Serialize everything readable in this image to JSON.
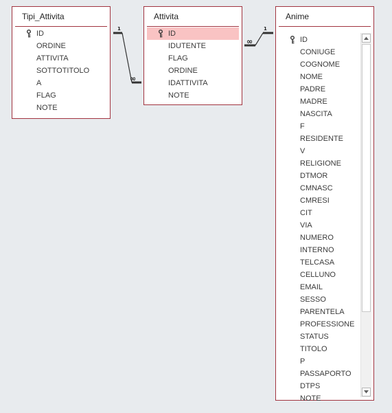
{
  "tables": {
    "tipi_attivita": {
      "title": "Tipi_Attivita",
      "fields": [
        "ID",
        "ORDINE",
        "ATTIVITA",
        "SOTTOTITOLO",
        "A",
        "FLAG",
        "NOTE"
      ]
    },
    "attivita": {
      "title": "Attivita",
      "fields": [
        "ID",
        "IDUTENTE",
        "FLAG",
        "ORDINE",
        "IDATTIVITA",
        "NOTE"
      ]
    },
    "anime": {
      "title": "Anime",
      "fields": [
        "ID",
        "CONIUGE",
        "COGNOME",
        "NOME",
        "PADRE",
        "MADRE",
        "NASCITA",
        "F",
        "RESIDENTE",
        "V",
        "RELIGIONE",
        "DTMOR",
        "CMNASC",
        "CMRESI",
        "CIT",
        "VIA",
        "NUMERO",
        "INTERNO",
        "TELCASA",
        "CELLUNO",
        "EMAIL",
        "SESSO",
        "PARENTELA",
        "PROFESSIONE",
        "STATUS",
        "TITOLO",
        "P",
        "PASSAPORTO",
        "DTPS",
        "NOTE"
      ]
    }
  },
  "relationships": {
    "rel1": {
      "one_label": "1",
      "many_label": "∞"
    },
    "rel2": {
      "one_label": "1",
      "many_label": "∞"
    }
  },
  "icons": {
    "primary_key": "key-icon",
    "scroll_up": "scroll-up-arrow-icon",
    "scroll_down": "scroll-down-arrow-icon"
  },
  "colors": {
    "border": "#a1333f",
    "selection": "#f9c3c3",
    "background": "#e8ebee"
  }
}
